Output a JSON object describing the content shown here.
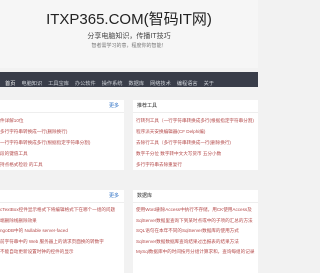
{
  "site": {
    "title": "ITXP365.COM(智码IT网)",
    "subtitle": "分享电脑知识，传播IT技巧",
    "slogan": "智者需学习的意，程度你的智能！"
  },
  "nav": {
    "items": [
      "首页",
      "电脑知识",
      "工具宝库",
      "办公软件",
      "操作系统",
      "数据库",
      "网络技术",
      "编程语言",
      "关于"
    ]
  },
  "left_panel": {
    "more": "更多",
    "items": [
      "件详解10位",
      "多行字符串转换成一行(删除换行)",
      "一行字符串转换成多行(根据指定字符串分割)",
      "段的键值工具",
      "持点格式检验 的工具"
    ]
  },
  "right_panel": {
    "title": "推荐工具",
    "items": [
      "行转列工具（一行字符串转换成多行(根据指定字符串分割)",
      "程序派天安换编辑器(CF Delphi编)",
      "去除行工具（多行字符串转换成一行(删除换行)",
      "数字千分位 数字转中文大写货币 五分小数",
      "多行字符串去除重复行"
    ]
  },
  "left_panel2": {
    "more": "更多",
    "items": [
      "cTextBox控件显示格式下将编辑格式下在哪个一组的问题",
      "端删除线删除效果",
      "ngoDB中的 Nullable server-faced",
      "前字符串中的 Web 服务器上的请求页面换的转数字",
      "不能自动更新设置时钟的控件的显示"
    ]
  },
  "right_panel2": {
    "title": "数据库",
    "items": [
      "使用Word删除Access中执行不存储，用CK使用Access及",
      "SqlServer数据里查询下到某时点或中的子项的汇总的方法",
      "SQL语句在本年不同的SqlServer数据库的使用方式",
      "SqlServer数据数据库查询结果过出报表的结果方法",
      "MySql数据库中的时间按月分组计算求和，查询每组的记录"
    ]
  }
}
